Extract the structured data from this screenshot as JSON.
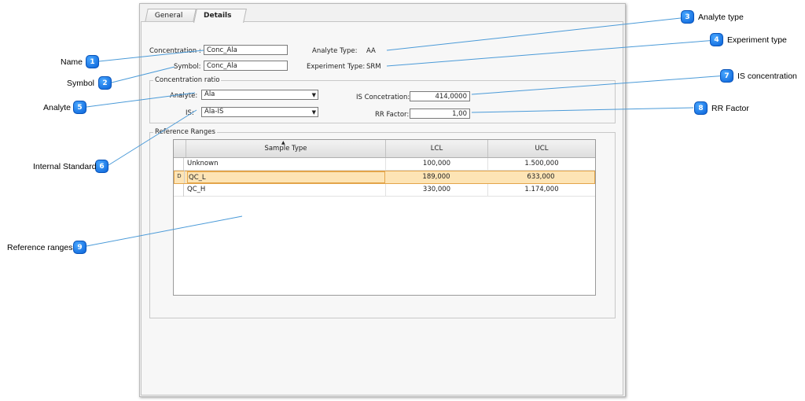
{
  "tabs": [
    {
      "label": "General",
      "active": false
    },
    {
      "label": "Details",
      "active": true
    }
  ],
  "form": {
    "concentration_label": "Concentration :",
    "concentration_value": "Conc_Ala",
    "symbol_label": "Symbol:",
    "symbol_value": "Conc_Ala",
    "analyte_type_label": "Analyte Type:",
    "analyte_type_value": "AA",
    "experiment_type_label": "Experiment Type:",
    "experiment_type_value": "SRM"
  },
  "concentration_ratio": {
    "title": "Concentration ratio",
    "analyte_label": "Analyte:",
    "analyte_value": "Ala",
    "is_label": "IS:",
    "is_value": "Ala-IS",
    "is_conc_label": "IS Concetration:",
    "is_conc_value": "414,0000",
    "rr_label": "RR Factor:",
    "rr_value": "1,00"
  },
  "reference_ranges": {
    "title": "Reference Ranges",
    "columns": [
      "Sample Type",
      "LCL",
      "UCL"
    ],
    "rows": [
      {
        "indicator": "",
        "sample_type": "Unknown",
        "lcl": "100,000",
        "ucl": "1.500,000",
        "selected": false
      },
      {
        "indicator": "D",
        "sample_type": "QC_L",
        "lcl": "189,000",
        "ucl": "633,000",
        "selected": true
      },
      {
        "indicator": "",
        "sample_type": "QC_H",
        "lcl": "330,000",
        "ucl": "1.174,000",
        "selected": false
      }
    ]
  },
  "callouts": [
    {
      "number": "1",
      "text": "Name"
    },
    {
      "number": "2",
      "text": "Symbol"
    },
    {
      "number": "3",
      "text": "Analyte type"
    },
    {
      "number": "4",
      "text": "Experiment type"
    },
    {
      "number": "5",
      "text": "Analyte"
    },
    {
      "number": "6",
      "text": "Internal Standard"
    },
    {
      "number": "7",
      "text": "IS concentration"
    },
    {
      "number": "8",
      "text": "RR Factor"
    },
    {
      "number": "9",
      "text": "Reference ranges"
    }
  ],
  "colors": {
    "badge": "#1a7cf0",
    "selected_row": "#fde4b5",
    "line": "#4a9ad8"
  }
}
